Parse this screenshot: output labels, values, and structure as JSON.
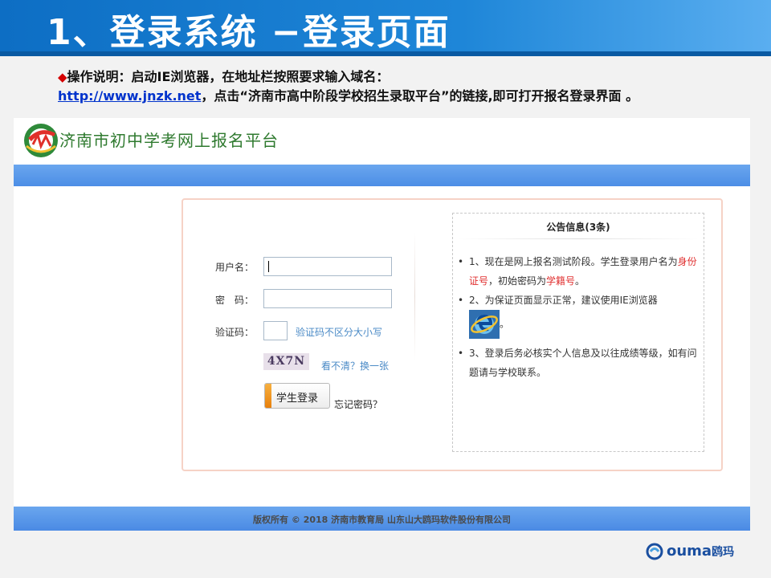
{
  "slide": {
    "title": "1、登录系统 −登录页面",
    "instruction_line1": "操作说明：启动IE浏览器，在地址栏按照要求输入域名：",
    "url_link": "http://www.jnzk.net",
    "instruction_line2": "，点击“济南市高中阶段学校招生录取平台”的链接,即可打开报名登录界面 。"
  },
  "site": {
    "title": "济南市初中学考网上报名平台",
    "logo_icon": "jinan-exam-logo-icon"
  },
  "login_form": {
    "username_label": "用户名：",
    "username_value": "",
    "password_label": "密　码：",
    "password_value": "",
    "captcha_label": "验证码：",
    "captcha_value": "",
    "captcha_hint": "验证码不区分大小写",
    "captcha_text": "4X7N",
    "refresh_captcha": "看不清？换一张",
    "login_button": "学生登录",
    "forgot_password": "忘记密码？"
  },
  "notice": {
    "title": "公告信息(3条)",
    "item1_prefix": "1、现在是网上报名测试阶段。学生登录用户名为",
    "item1_red1": "身份证号",
    "item1_middle": "，初始密码为",
    "item1_red2": "学籍号",
    "item1_suffix": "。",
    "item2_text": "2、为保证页面显示正常，建议使用IE浏览器",
    "item2_suffix": "。",
    "item3_text": "3、登录后务必核实个人信息及以往成绩等级，如有问题请与学校联系。"
  },
  "footer": {
    "copyright": "版权所有 © 2018  济南市教育局  山东山大鸥玛软件股份有限公司"
  },
  "brand": {
    "name": "ouma",
    "name_cn": "鸥玛"
  },
  "colors": {
    "banner_blue": "#1e86d8",
    "site_title_green": "#2f7a2f",
    "link_blue": "#0033cc",
    "notice_red": "#e03030",
    "bar_blue": "#4c8ee6"
  }
}
